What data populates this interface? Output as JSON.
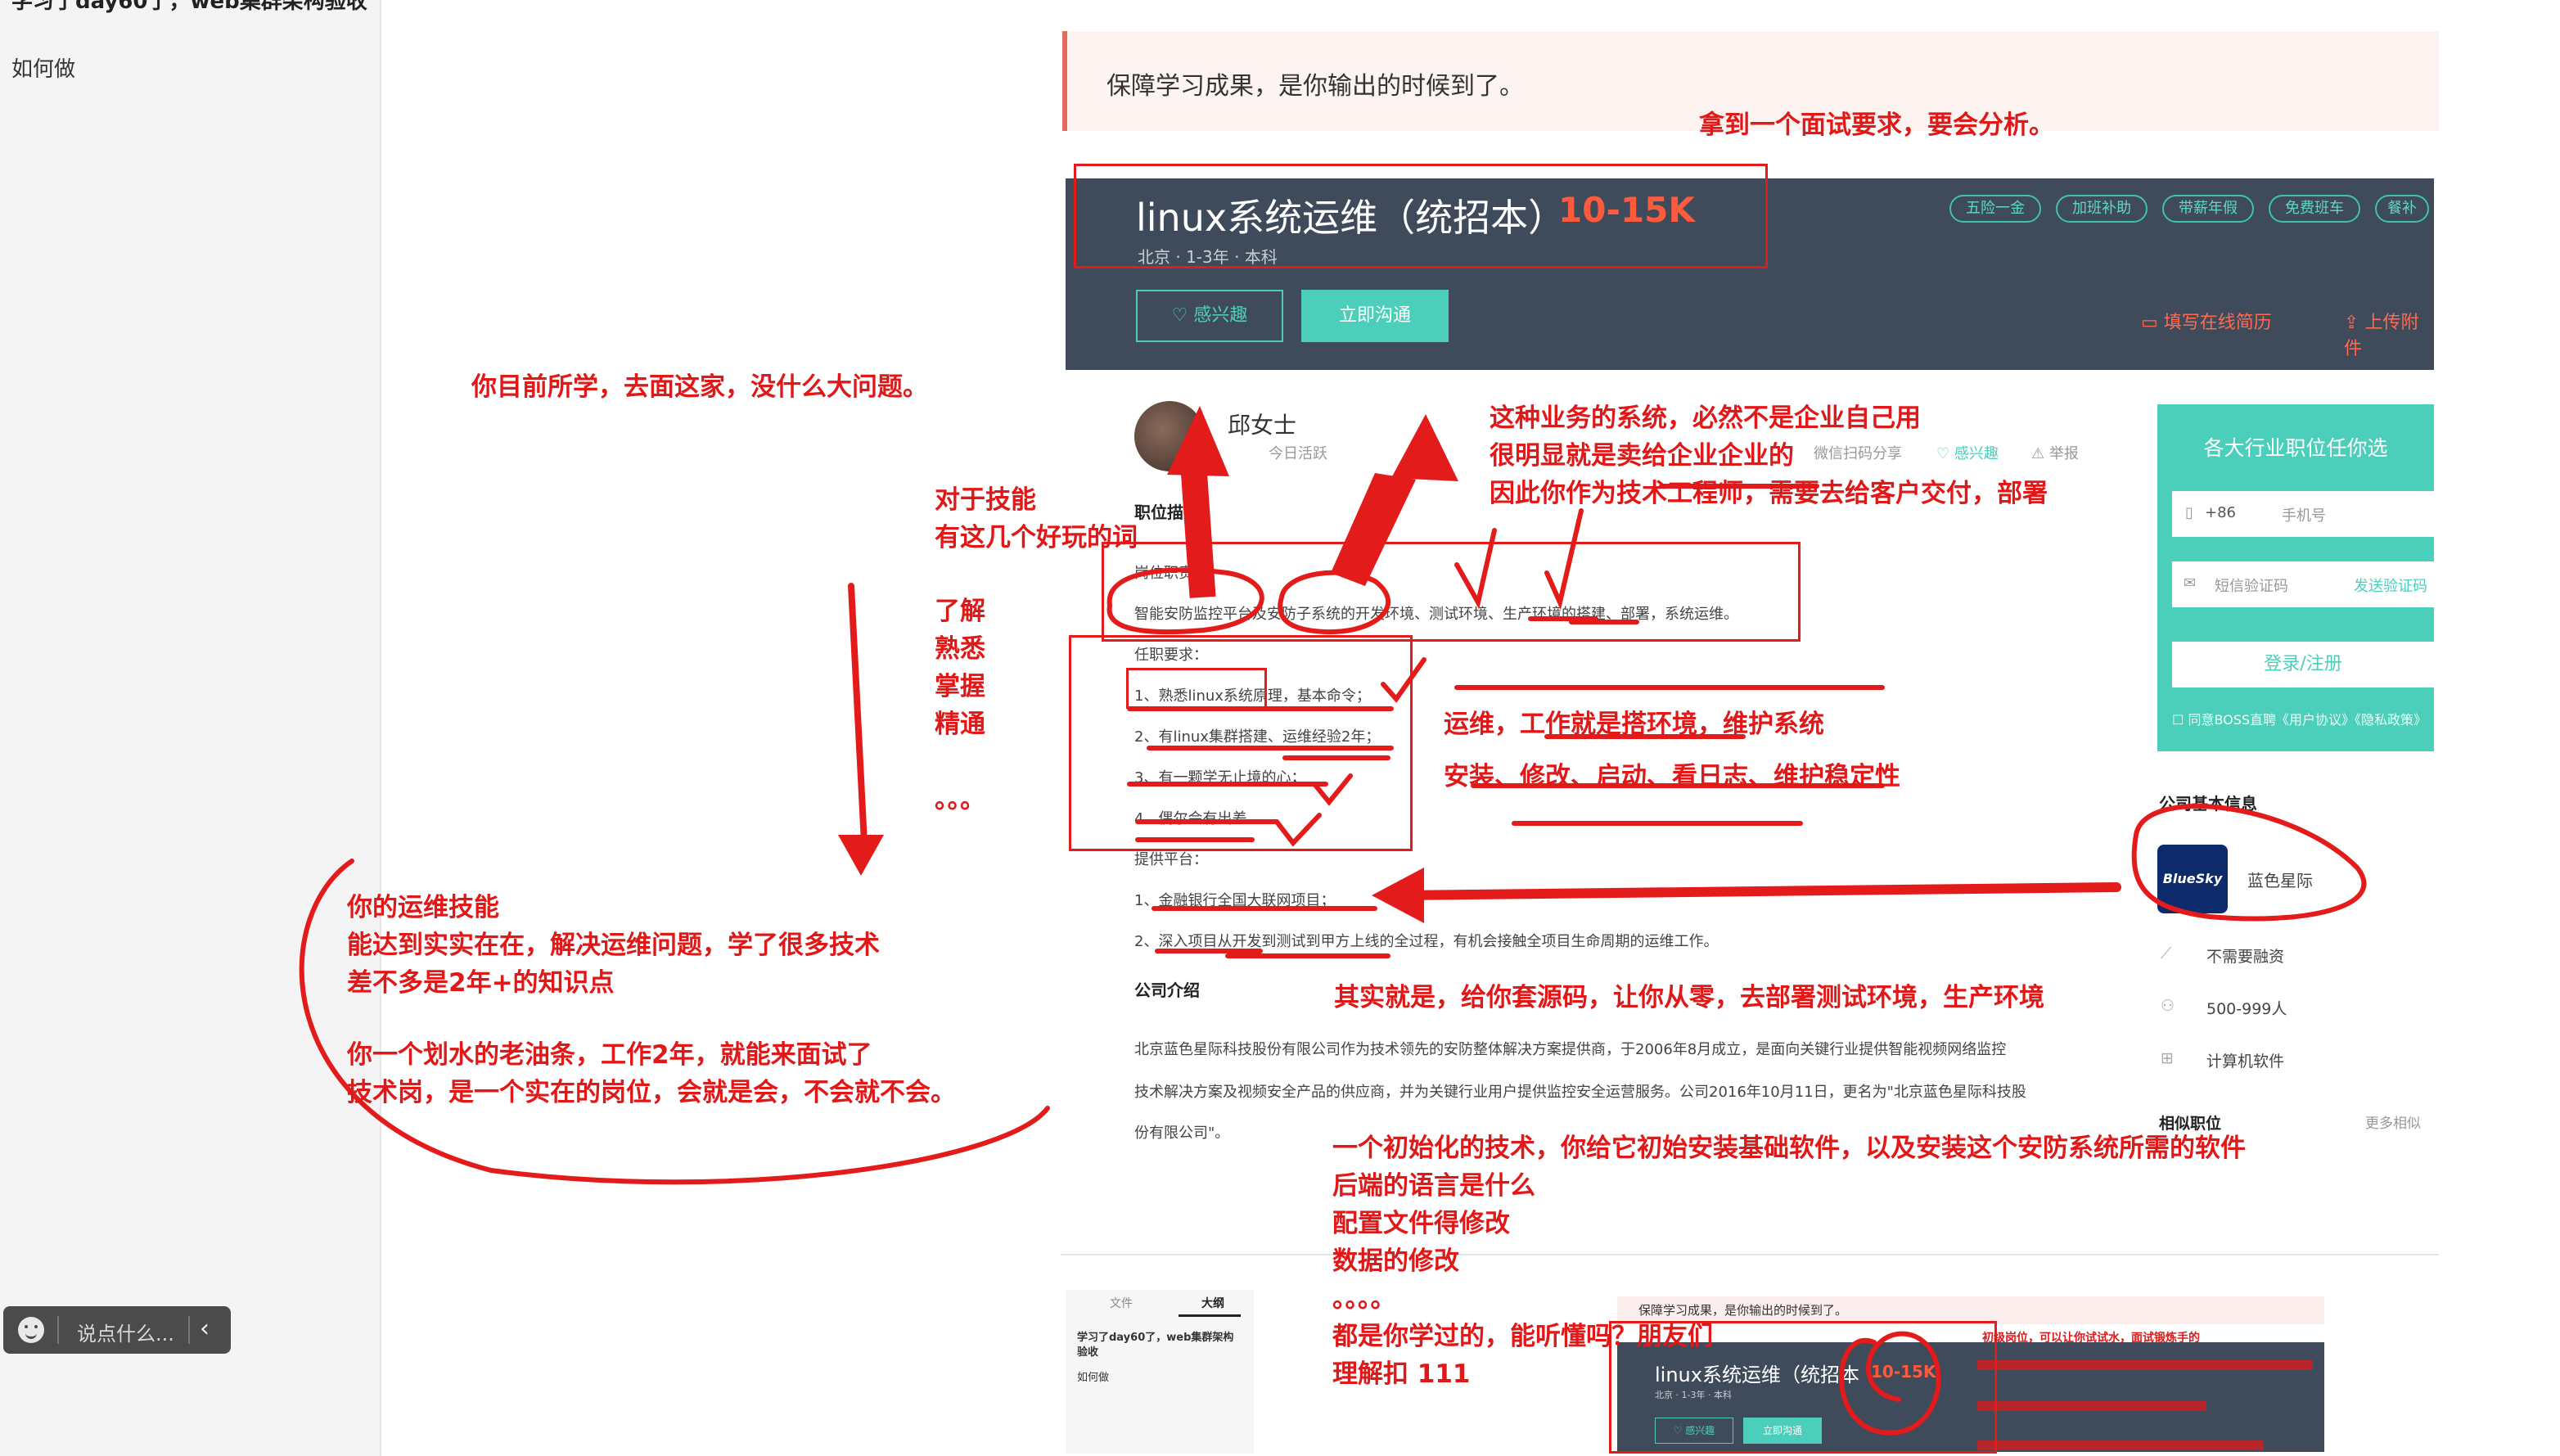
{
  "sidebar": {
    "title": "学习了day60了，web集群架构验收",
    "how": "如何做",
    "chat_placeholder": "说点什么...",
    "back_icon": "‹"
  },
  "quote": "保障学习成果，是你输出的时候到了。",
  "job": {
    "title": "linux系统运维（统招本）",
    "salary": "10-15K",
    "meta": "北京 · 1-3年 · 本科",
    "tags": [
      "五险一金",
      "加班补助",
      "带薪年假",
      "免费班车",
      "餐补"
    ],
    "interest_btn": "♡ 感兴趣",
    "chat_btn": "立即沟通",
    "resume_link": "填写在线简历",
    "upload_link": "上传附件"
  },
  "recruiter": {
    "name": "邱女士",
    "status": "今日活跃",
    "share": "微信扫码分享",
    "interested": "♡ 感兴趣",
    "report": "⚠ 举报"
  },
  "jd": {
    "heading": "职位描述",
    "duty_label": "岗位职责：",
    "duty_text": "智能安防监控平台及安防子系统的开发环境、测试环境、生产环境的搭建、部署，系统运维。",
    "req_label": "任职要求：",
    "reqs": [
      "1、熟悉linux系统原理，基本命令；",
      "2、有linux集群搭建、运维经验2年；",
      "3、有一颗学无止境的心；",
      "4、偶尔会有出差。"
    ],
    "platform_label": "提供平台：",
    "platforms": [
      "1、金融银行全国大联网项目；",
      "2、深入项目从开发到测试到甲方上线的全过程，有机会接触全项目生命周期的运维工作。"
    ],
    "company_heading": "公司介绍",
    "company_lines": [
      "北京蓝色星际科技股份有限公司作为技术领先的安防整体解决方案提供商，于2006年8月成立，是面向关键行业提供智能视频网络监控",
      "技术解决方案及视频安全产品的供应商，并为关键行业用户提供监控安全运营服务。公司2016年10月11日，更名为\"北京蓝色星际科技股",
      "份有限公司\"。"
    ]
  },
  "register": {
    "heading": "各大行业职位任你选",
    "country_code": "+86",
    "phone_placeholder": "手机号",
    "code_placeholder": "短信验证码",
    "send_code": "发送验证码",
    "login_btn": "登录/注册",
    "agree": "同意BOSS直聘《用户协议》《隐私政策》"
  },
  "company": {
    "heading": "公司基本信息",
    "logo_text": "BlueSky",
    "name": "蓝色星际",
    "financing": "不需要融资",
    "size": "500-999人",
    "industry": "计算机软件",
    "similar": "相似职位",
    "more": "更多相似"
  },
  "annotations": {
    "analyze": "拿到一个面试要求，要会分析。",
    "current": "你目前所学，去面这家，没什么大问题。",
    "skills_1": "对于技能",
    "skills_2": "有这几个好玩的词",
    "level_1": "了解",
    "level_2": "熟悉",
    "level_3": "掌握",
    "level_4": "精通",
    "level_dots": "。。。",
    "biz_1": "这种业务的系统，必然不是企业自己用",
    "biz_2": "很明显就是卖给企业企业的",
    "biz_3": "因此你作为技术工程师，需要去给客户交付，部署",
    "ops_1": "运维，工作就是搭环境，维护系统",
    "ops_2": "安装、修改、启动、看日志、维护稳定性",
    "source": "其实就是，给你套源码，让你从零，去部署测试环境，生产环境",
    "skill_a": "你的运维技能",
    "skill_b": "能达到实实在在，解决运维问题，学了很多技术",
    "skill_c": "差不多是2年+的知识点",
    "skill_d": "你一个划水的老油条，工作2年，就能来面试了",
    "skill_e": "技术岗，是一个实在的岗位，会就是会，不会就不会。",
    "init_1": "一个初始化的技术，你给它初始安装基础软件，以及安装这个安防系统所需的软件",
    "init_2": "后端的语言是什么",
    "init_3": "配置文件得修改",
    "init_4": "数据的修改",
    "init_5": "。。。。",
    "init_6": "都是你学过的，能听懂吗？朋友们",
    "init_7": "理解扣  111",
    "thumb_red": "初级岗位，可以让你试试水，面试锻炼手的"
  },
  "thumb": {
    "tab1": "文件",
    "tab2": "大纲",
    "title": "学习了day60了，web集群架构验收",
    "how": "如何做",
    "quote": "保障学习成果，是你输出的时候到了。",
    "job": "linux系统运维（统招本",
    "salary": "10-15K",
    "meta": "北京 · 1-3年 · 本科",
    "interest": "♡ 感兴趣",
    "chat": "立即沟通"
  },
  "colors": {
    "annotation": "#e01818",
    "header_bg": "#3f4b5b",
    "accent": "#4ccfba",
    "salary": "#ff5a3c"
  }
}
